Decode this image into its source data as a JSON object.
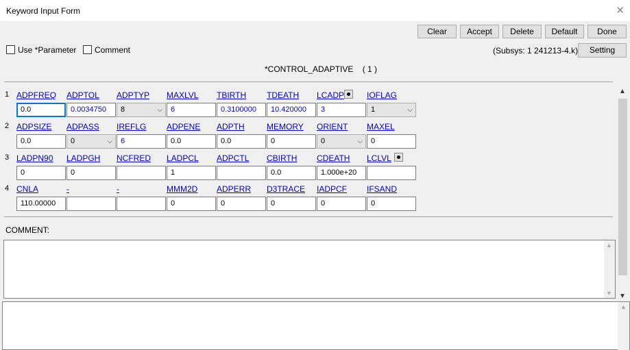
{
  "window": {
    "title": "Keyword Input Form"
  },
  "toolbar": {
    "clear": "Clear",
    "accept": "Accept",
    "delete": "Delete",
    "default": "Default",
    "done": "Done"
  },
  "options": {
    "use_parameter": "Use *Parameter",
    "comment": "Comment"
  },
  "subsys": "(Subsys: 1 241213-4.k)",
  "setting": "Setting",
  "keyword": {
    "name": "*CONTROL_ADAPTIVE",
    "count": "( 1 )"
  },
  "rows": [
    {
      "num": "1",
      "fields": [
        {
          "label": "ADPFREQ",
          "value": "0.0",
          "type": "input",
          "blue": false,
          "focus": true
        },
        {
          "label": "ADPTOL",
          "value": "0.0034750",
          "type": "input",
          "blue": true
        },
        {
          "label": "ADPTYP",
          "value": "8",
          "type": "select"
        },
        {
          "label": "MAXLVL",
          "value": "6",
          "type": "input",
          "blue": true
        },
        {
          "label": "TBIRTH",
          "value": "0.3100000",
          "type": "input",
          "blue": true
        },
        {
          "label": "TDEATH",
          "value": "10.420000",
          "type": "input",
          "blue": true
        },
        {
          "label": "LCADP",
          "value": "3",
          "type": "input",
          "blue": true,
          "dot": true
        },
        {
          "label": "IOFLAG",
          "value": "1",
          "type": "select"
        }
      ]
    },
    {
      "num": "2",
      "fields": [
        {
          "label": "ADPSIZE",
          "value": "0.0",
          "type": "input"
        },
        {
          "label": "ADPASS",
          "value": "0",
          "type": "select"
        },
        {
          "label": "IREFLG",
          "value": "6",
          "type": "input",
          "blue": true
        },
        {
          "label": "ADPENE",
          "value": "0.0",
          "type": "input"
        },
        {
          "label": "ADPTH",
          "value": "0.0",
          "type": "input"
        },
        {
          "label": "MEMORY",
          "value": "0",
          "type": "input"
        },
        {
          "label": "ORIENT",
          "value": "0",
          "type": "select"
        },
        {
          "label": "MAXEL",
          "value": "0",
          "type": "input"
        }
      ]
    },
    {
      "num": "3",
      "fields": [
        {
          "label": "LADPN90",
          "value": "0",
          "type": "input"
        },
        {
          "label": "LADPGH",
          "value": "0",
          "type": "input"
        },
        {
          "label": "NCFRED",
          "value": "",
          "type": "input"
        },
        {
          "label": "LADPCL",
          "value": "1",
          "type": "input"
        },
        {
          "label": "ADPCTL",
          "value": "",
          "type": "input"
        },
        {
          "label": "CBIRTH",
          "value": "0.0",
          "type": "input"
        },
        {
          "label": "CDEATH",
          "value": "1.000e+20",
          "type": "input"
        },
        {
          "label": "LCLVL",
          "value": "",
          "type": "input",
          "dot": true
        }
      ]
    },
    {
      "num": "4",
      "fields": [
        {
          "label": "CNLA",
          "value": "110.00000",
          "type": "input"
        },
        {
          "label": "-",
          "value": "",
          "type": "input"
        },
        {
          "label": "-",
          "value": "",
          "type": "input"
        },
        {
          "label": "MMM2D",
          "value": "0",
          "type": "input"
        },
        {
          "label": "ADPERR",
          "value": "0",
          "type": "input"
        },
        {
          "label": "D3TRACE",
          "value": "0",
          "type": "input"
        },
        {
          "label": "IADPCF",
          "value": "0",
          "type": "input"
        },
        {
          "label": "IFSAND",
          "value": "0",
          "type": "input"
        }
      ]
    }
  ],
  "comment_label": "COMMENT:",
  "comment_text": "",
  "icons": {
    "close": "close-icon",
    "dropdown": "chevron-down-icon",
    "curve": "curve-select-icon",
    "scroll_up": "chevron-up-icon",
    "scroll_down": "chevron-down-icon"
  }
}
